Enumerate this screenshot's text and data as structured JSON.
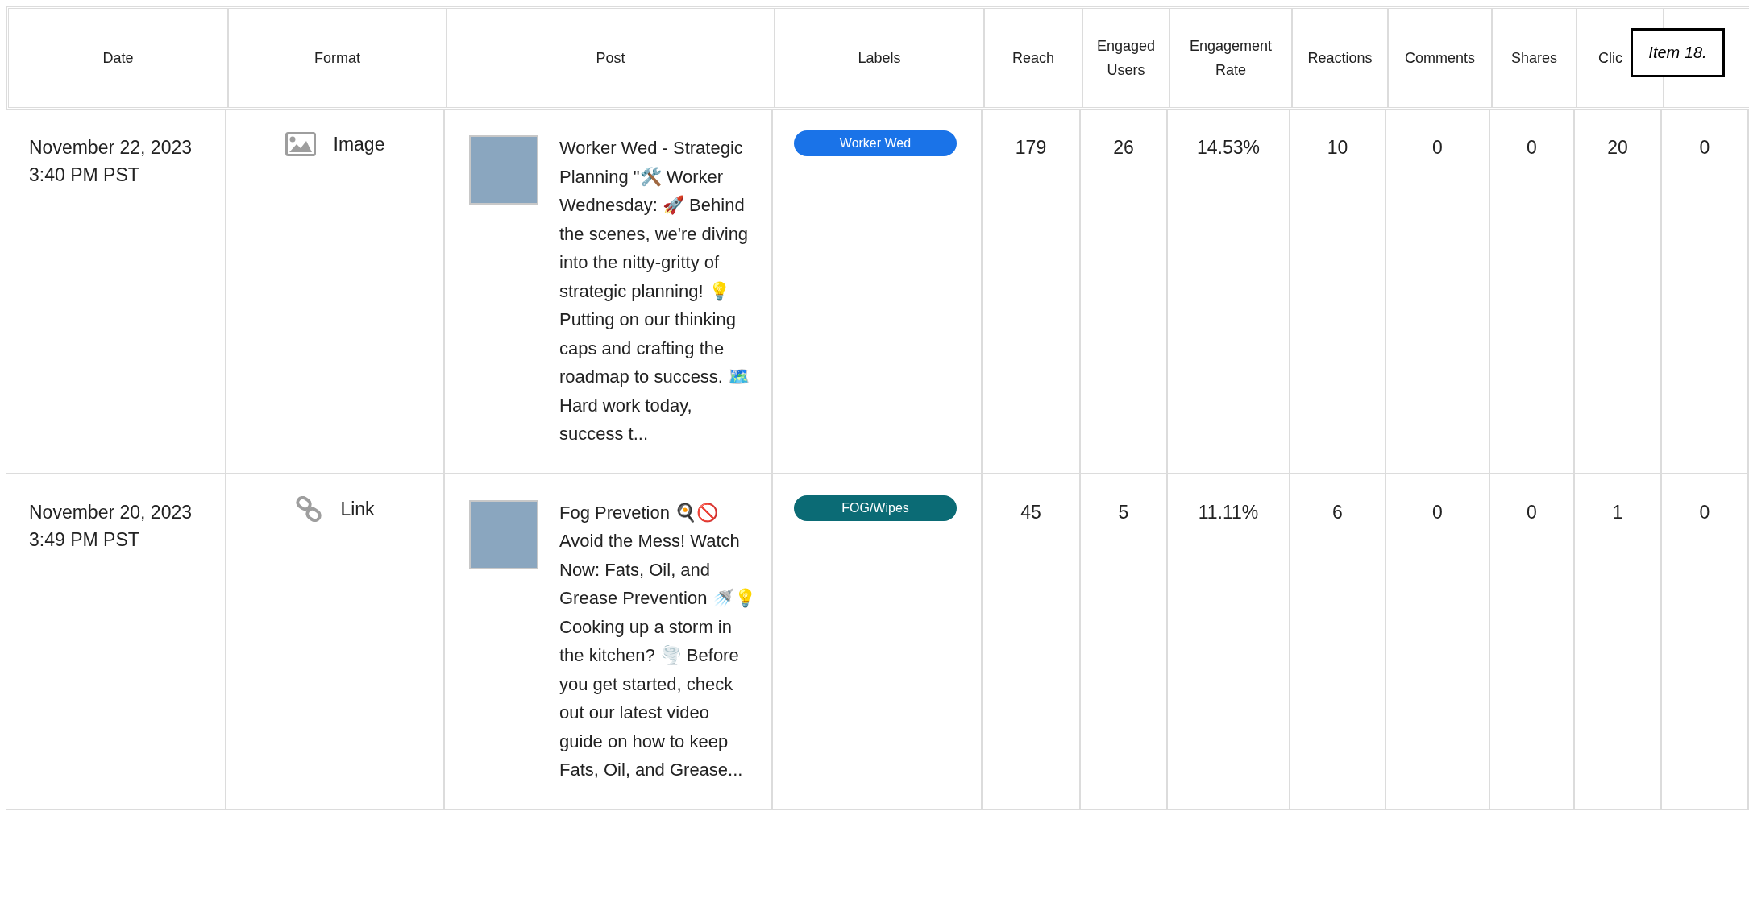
{
  "table": {
    "columns": [
      "Date",
      "Format",
      "Post",
      "Labels",
      "Reach",
      "Engaged Users",
      "Engagement Rate",
      "Reactions",
      "Comments",
      "Shares",
      "Clic",
      ""
    ],
    "rows": [
      {
        "date": "November 22, 2023",
        "time": "3:40 PM PST",
        "format": {
          "kind": "image",
          "label": "Image"
        },
        "post": "Worker Wed - Strategic Planning \"🛠️ Worker Wednesday: 🚀 Behind the scenes, we're diving into the nitty-gritty of strategic planning! 💡 Putting on our thinking caps and crafting the roadmap to success. 🗺️ Hard work today, success t...",
        "label": {
          "text": "Worker Wed",
          "color": "#1a73e8"
        },
        "reach": "179",
        "engaged_users": "26",
        "engagement_rate": "14.53%",
        "reactions": "10",
        "comments": "0",
        "shares": "0",
        "clicks": "20",
        "column_12": "0"
      },
      {
        "date": "November 20, 2023",
        "time": "3:49 PM PST",
        "format": {
          "kind": "link",
          "label": "Link"
        },
        "post": "Fog Prevetion 🍳🚫 Avoid the Mess! Watch Now: Fats, Oil, and Grease Prevention 🚿💡 Cooking up a storm in the kitchen? 🌪️ Before you get started, check out our latest video guide on how to keep Fats, Oil, and Grease...",
        "label": {
          "text": "FOG/Wipes",
          "color": "#0b6b75"
        },
        "reach": "45",
        "engaged_users": "5",
        "engagement_rate": "11.11%",
        "reactions": "6",
        "comments": "0",
        "shares": "0",
        "clicks": "1",
        "column_12": "0"
      }
    ]
  },
  "overlay_label": "Item 18."
}
